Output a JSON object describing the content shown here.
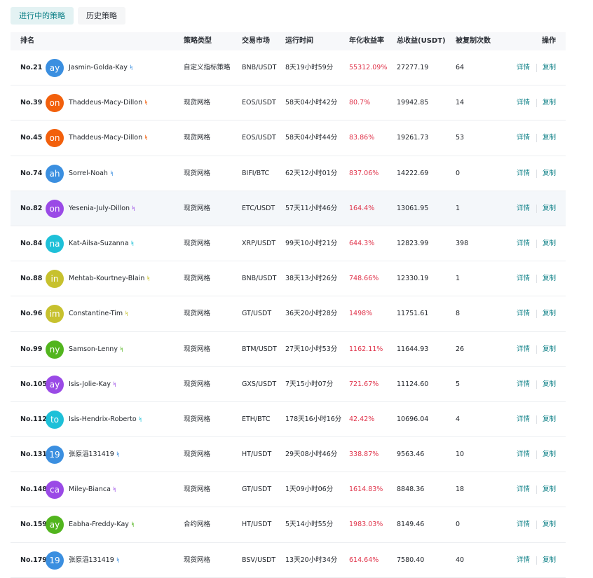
{
  "tabs": [
    {
      "label": "进行中的策略",
      "active": true
    },
    {
      "label": "历史策略",
      "active": false
    }
  ],
  "columns": {
    "rank": "排名",
    "type": "策略类型",
    "market": "交易市场",
    "runtime": "运行时间",
    "rate": "年化收益率",
    "profit": "总收益(USDT)",
    "copies": "被复制次数",
    "action": "操作"
  },
  "actions": {
    "detail": "详情",
    "copy": "复制"
  },
  "rows": [
    {
      "rank": "No.21",
      "avatar": "ay",
      "avatar_color": "#3b8fe0",
      "name": "Jasmin-Golda-Kay",
      "badge_color": "#3b8fe0",
      "type": "自定义指标策略",
      "market": "BNB/USDT",
      "runtime": "8天19小时59分",
      "rate": "55312.09%",
      "profit": "27277.19",
      "copies": "64"
    },
    {
      "rank": "No.39",
      "avatar": "on",
      "avatar_color": "#f2600c",
      "name": "Thaddeus-Macy-Dillon",
      "badge_color": "#f2600c",
      "type": "现货网格",
      "market": "EOS/USDT",
      "runtime": "58天04小时42分",
      "rate": "80.7%",
      "profit": "19942.85",
      "copies": "14"
    },
    {
      "rank": "No.45",
      "avatar": "on",
      "avatar_color": "#f2600c",
      "name": "Thaddeus-Macy-Dillon",
      "badge_color": "#f2600c",
      "type": "现货网格",
      "market": "EOS/USDT",
      "runtime": "58天04小时44分",
      "rate": "83.86%",
      "profit": "19261.73",
      "copies": "53"
    },
    {
      "rank": "No.74",
      "avatar": "ah",
      "avatar_color": "#3b8fe0",
      "name": "Sorrel-Noah",
      "badge_color": "#3b8fe0",
      "type": "现货网格",
      "market": "BIFI/BTC",
      "runtime": "62天12小时01分",
      "rate": "837.06%",
      "profit": "14222.69",
      "copies": "0"
    },
    {
      "rank": "No.82",
      "avatar": "on",
      "avatar_color": "#9a4ae6",
      "name": "Yesenia-July-Dillon",
      "badge_color": "#9a4ae6",
      "type": "现货网格",
      "market": "ETC/USDT",
      "runtime": "57天11小时46分",
      "rate": "164.4%",
      "profit": "13061.95",
      "copies": "1",
      "highlight": true
    },
    {
      "rank": "No.84",
      "avatar": "na",
      "avatar_color": "#1ec0d8",
      "name": "Kat-Ailsa-Suzanna",
      "badge_color": "#1ec0d8",
      "type": "现货网格",
      "market": "XRP/USDT",
      "runtime": "99天10小时21分",
      "rate": "644.3%",
      "profit": "12823.99",
      "copies": "398"
    },
    {
      "rank": "No.88",
      "avatar": "in",
      "avatar_color": "#c7c12e",
      "name": "Mehtab-Kourtney-Blain",
      "badge_color": "#c7c12e",
      "type": "现货网格",
      "market": "BNB/USDT",
      "runtime": "38天13小时26分",
      "rate": "748.66%",
      "profit": "12330.19",
      "copies": "1"
    },
    {
      "rank": "No.96",
      "avatar": "im",
      "avatar_color": "#c7c12e",
      "name": "Constantine-Tim",
      "badge_color": "#c7c12e",
      "type": "现货网格",
      "market": "GT/USDT",
      "runtime": "36天20小时28分",
      "rate": "1498%",
      "profit": "11751.61",
      "copies": "8"
    },
    {
      "rank": "No.99",
      "avatar": "ny",
      "avatar_color": "#52b51e",
      "name": "Samson-Lenny",
      "badge_color": "#52b51e",
      "type": "现货网格",
      "market": "BTM/USDT",
      "runtime": "27天10小时53分",
      "rate": "1162.11%",
      "profit": "11644.93",
      "copies": "26"
    },
    {
      "rank": "No.105",
      "avatar": "ay",
      "avatar_color": "#9a4ae6",
      "name": "Isis-Jolie-Kay",
      "badge_color": "#9a4ae6",
      "type": "现货网格",
      "market": "GXS/USDT",
      "runtime": "7天15小时07分",
      "rate": "721.67%",
      "profit": "11124.60",
      "copies": "5"
    },
    {
      "rank": "No.112",
      "avatar": "to",
      "avatar_color": "#1ec0d8",
      "name": "Isis-Hendrix-Roberto",
      "badge_color": "#1ec0d8",
      "type": "现货网格",
      "market": "ETH/BTC",
      "runtime": "178天16小时16分",
      "rate": "42.42%",
      "profit": "10696.04",
      "copies": "4"
    },
    {
      "rank": "No.131",
      "avatar": "19",
      "avatar_color": "#3b8fe0",
      "name": "张原滔131419",
      "badge_color": "#3b8fe0",
      "type": "现货网格",
      "market": "HT/USDT",
      "runtime": "29天08小时46分",
      "rate": "338.87%",
      "profit": "9563.46",
      "copies": "10"
    },
    {
      "rank": "No.148",
      "avatar": "ca",
      "avatar_color": "#9a4ae6",
      "name": "Miley-Bianca",
      "badge_color": "#9a4ae6",
      "type": "现货网格",
      "market": "GT/USDT",
      "runtime": "1天09小时06分",
      "rate": "1614.83%",
      "profit": "8848.36",
      "copies": "18"
    },
    {
      "rank": "No.159",
      "avatar": "ay",
      "avatar_color": "#52b51e",
      "name": "Eabha-Freddy-Kay",
      "badge_color": "#52b51e",
      "type": "合约网格",
      "market": "HT/USDT",
      "runtime": "5天14小时55分",
      "rate": "1983.03%",
      "profit": "8149.46",
      "copies": "0"
    },
    {
      "rank": "No.179",
      "avatar": "19",
      "avatar_color": "#3b8fe0",
      "name": "张原滔131419",
      "badge_color": "#3b8fe0",
      "type": "现货网格",
      "market": "BSV/USDT",
      "runtime": "13天20小时34分",
      "rate": "614.64%",
      "profit": "7580.40",
      "copies": "40"
    }
  ]
}
